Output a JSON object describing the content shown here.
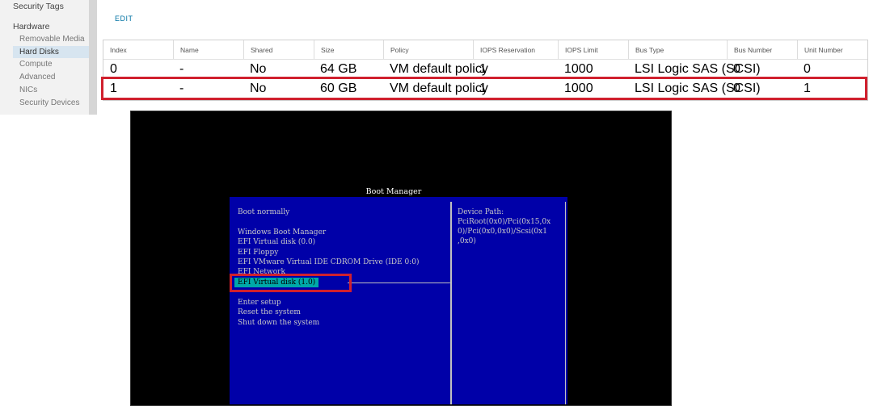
{
  "sidebar": {
    "top_item": "Security Tags",
    "section": "Hardware",
    "items": [
      {
        "label": "Removable Media",
        "selected": false
      },
      {
        "label": "Hard Disks",
        "selected": true
      },
      {
        "label": "Compute",
        "selected": false
      },
      {
        "label": "Advanced",
        "selected": false
      },
      {
        "label": "NICs",
        "selected": false
      },
      {
        "label": "Security Devices",
        "selected": false
      }
    ]
  },
  "toolbar": {
    "edit_label": "EDIT"
  },
  "table": {
    "columns": [
      "Index",
      "Name",
      "Shared",
      "Size",
      "Policy",
      "IOPS Reservation",
      "IOPS Limit",
      "Bus Type",
      "Bus Number",
      "Unit Number"
    ],
    "rows": [
      [
        "0",
        "-",
        "No",
        "64 GB",
        "VM default policy",
        "1",
        "1000",
        "LSI Logic SAS (SCSI)",
        "0",
        "0"
      ],
      [
        "1",
        "-",
        "No",
        "60 GB",
        "VM default policy",
        "1",
        "1000",
        "LSI Logic SAS (SCSI)",
        "0",
        "1"
      ]
    ]
  },
  "boot_manager": {
    "title": "Boot Manager",
    "items": [
      "Boot normally",
      "Windows Boot Manager",
      "EFI Virtual disk (0.0)",
      "EFI Floppy",
      "EFI VMware Virtual IDE CDROM Drive (IDE 0:0)",
      "EFI Network",
      "EFI Virtual disk (1.0)",
      "Enter setup",
      "Reset the system",
      "Shut down the system"
    ],
    "selected_item": "EFI Virtual disk (1.0)",
    "device_path_lines": [
      "Device Path:",
      "PciRoot(0x0)/Pci(0x15,0x",
      "0)/Pci(0x0,0x0)/Scsi(0x1",
      ",0x0)"
    ]
  },
  "colors": {
    "highlight": "#d0202e",
    "boot_bg": "#0000a8",
    "boot_select": "#00a8a8",
    "sidebar_select": "#d7e5f0",
    "link": "#0072a3"
  }
}
